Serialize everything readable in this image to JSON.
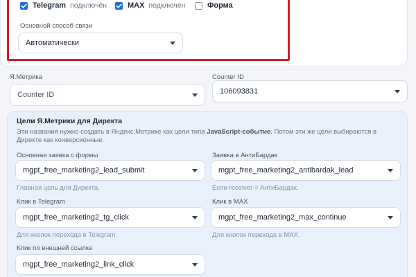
{
  "channels": {
    "items": [
      {
        "name": "Telegram",
        "status": "подключён",
        "checked": true
      },
      {
        "name": "MAX",
        "status": "подключён",
        "checked": true
      },
      {
        "name": "Форма",
        "status": "",
        "checked": false
      }
    ],
    "primary_label": "Основной способ связи",
    "primary_value": "Автоматически"
  },
  "metrika": {
    "label": "Я.Метрика",
    "value": "Counter ID",
    "counter_label": "Counter ID",
    "counter_value": "106093831"
  },
  "goals": {
    "title": "Цели Я.Метрики для Директа",
    "desc_part1": "Эти названия нужно создать в Яндекс.Метрике как цели типа ",
    "desc_bold": "JavaScript-событие",
    "desc_part2": ". Потом эти же цели выбираются в Директе как конверсионные.",
    "fields": [
      {
        "label": "Основная заявка с формы",
        "value": "mgpt_free_marketing2_lead_submit",
        "hint": "Главная цель для Директа."
      },
      {
        "label": "Заявка в АнтиБардак",
        "value": "mgpt_free_marketing2_antibardak_lead",
        "hint": "Если receiver = АнтиБардак."
      },
      {
        "label": "Клик в Telegram",
        "value": "mgpt_free_marketing2_tg_click",
        "hint": "Для кнопок перехода в Telegram."
      },
      {
        "label": "Клик в MAX",
        "value": "mgpt_free_marketing2_max_continue",
        "hint": "Для кнопок перехода в MAX."
      },
      {
        "label": "Клик по внешней ссылке",
        "value": "mgpt_free_marketing2_link_click",
        "hint": ""
      }
    ]
  },
  "colors": {
    "accent": "#1d6fdc",
    "highlight_border": "#d11f2a",
    "panel_bg": "#e8f0fb"
  }
}
